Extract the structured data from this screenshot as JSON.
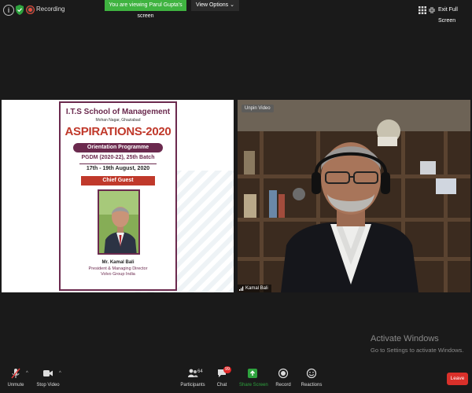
{
  "topbar": {
    "recording_label": "Recording",
    "viewing_banner": "You are viewing Parul Gupta's screen",
    "view_options_label": "View Options",
    "exit_fullscreen_label": "Exit Full Screen"
  },
  "shared_screen": {
    "poster": {
      "school": "I.T.S School of Management",
      "location": "Mohan Nagar, Ghaziabad",
      "title": "ASPIRATIONS-2020",
      "programme": "Orientation Programme",
      "batch": "PGDM (2020-22), 25th Batch",
      "dates": "17th - 19th August, 2020",
      "guest_heading": "Chief Guest",
      "guest_name": "Mr. Kamal Bali",
      "guest_role": "President & Managing Director",
      "guest_org": "Volvo Group India"
    }
  },
  "video": {
    "unpin_label": "Unpin Video",
    "participant_name": "Kamal Bali"
  },
  "watermark": {
    "title": "Activate Windows",
    "subtitle": "Go to Settings to activate Windows."
  },
  "toolbar": {
    "unmute": "Unmute",
    "stop_video": "Stop Video",
    "participants": "Participants",
    "participants_count": "64",
    "chat": "Chat",
    "chat_badge": "99",
    "share_screen": "Share Screen",
    "record": "Record",
    "reactions": "Reactions",
    "leave": "Leave"
  },
  "colors": {
    "banner_green": "#3fb340",
    "share_green": "#2ea33e",
    "leave_red": "#d9302a",
    "poster_maroon": "#6b2a4e",
    "poster_red": "#c0392b"
  }
}
